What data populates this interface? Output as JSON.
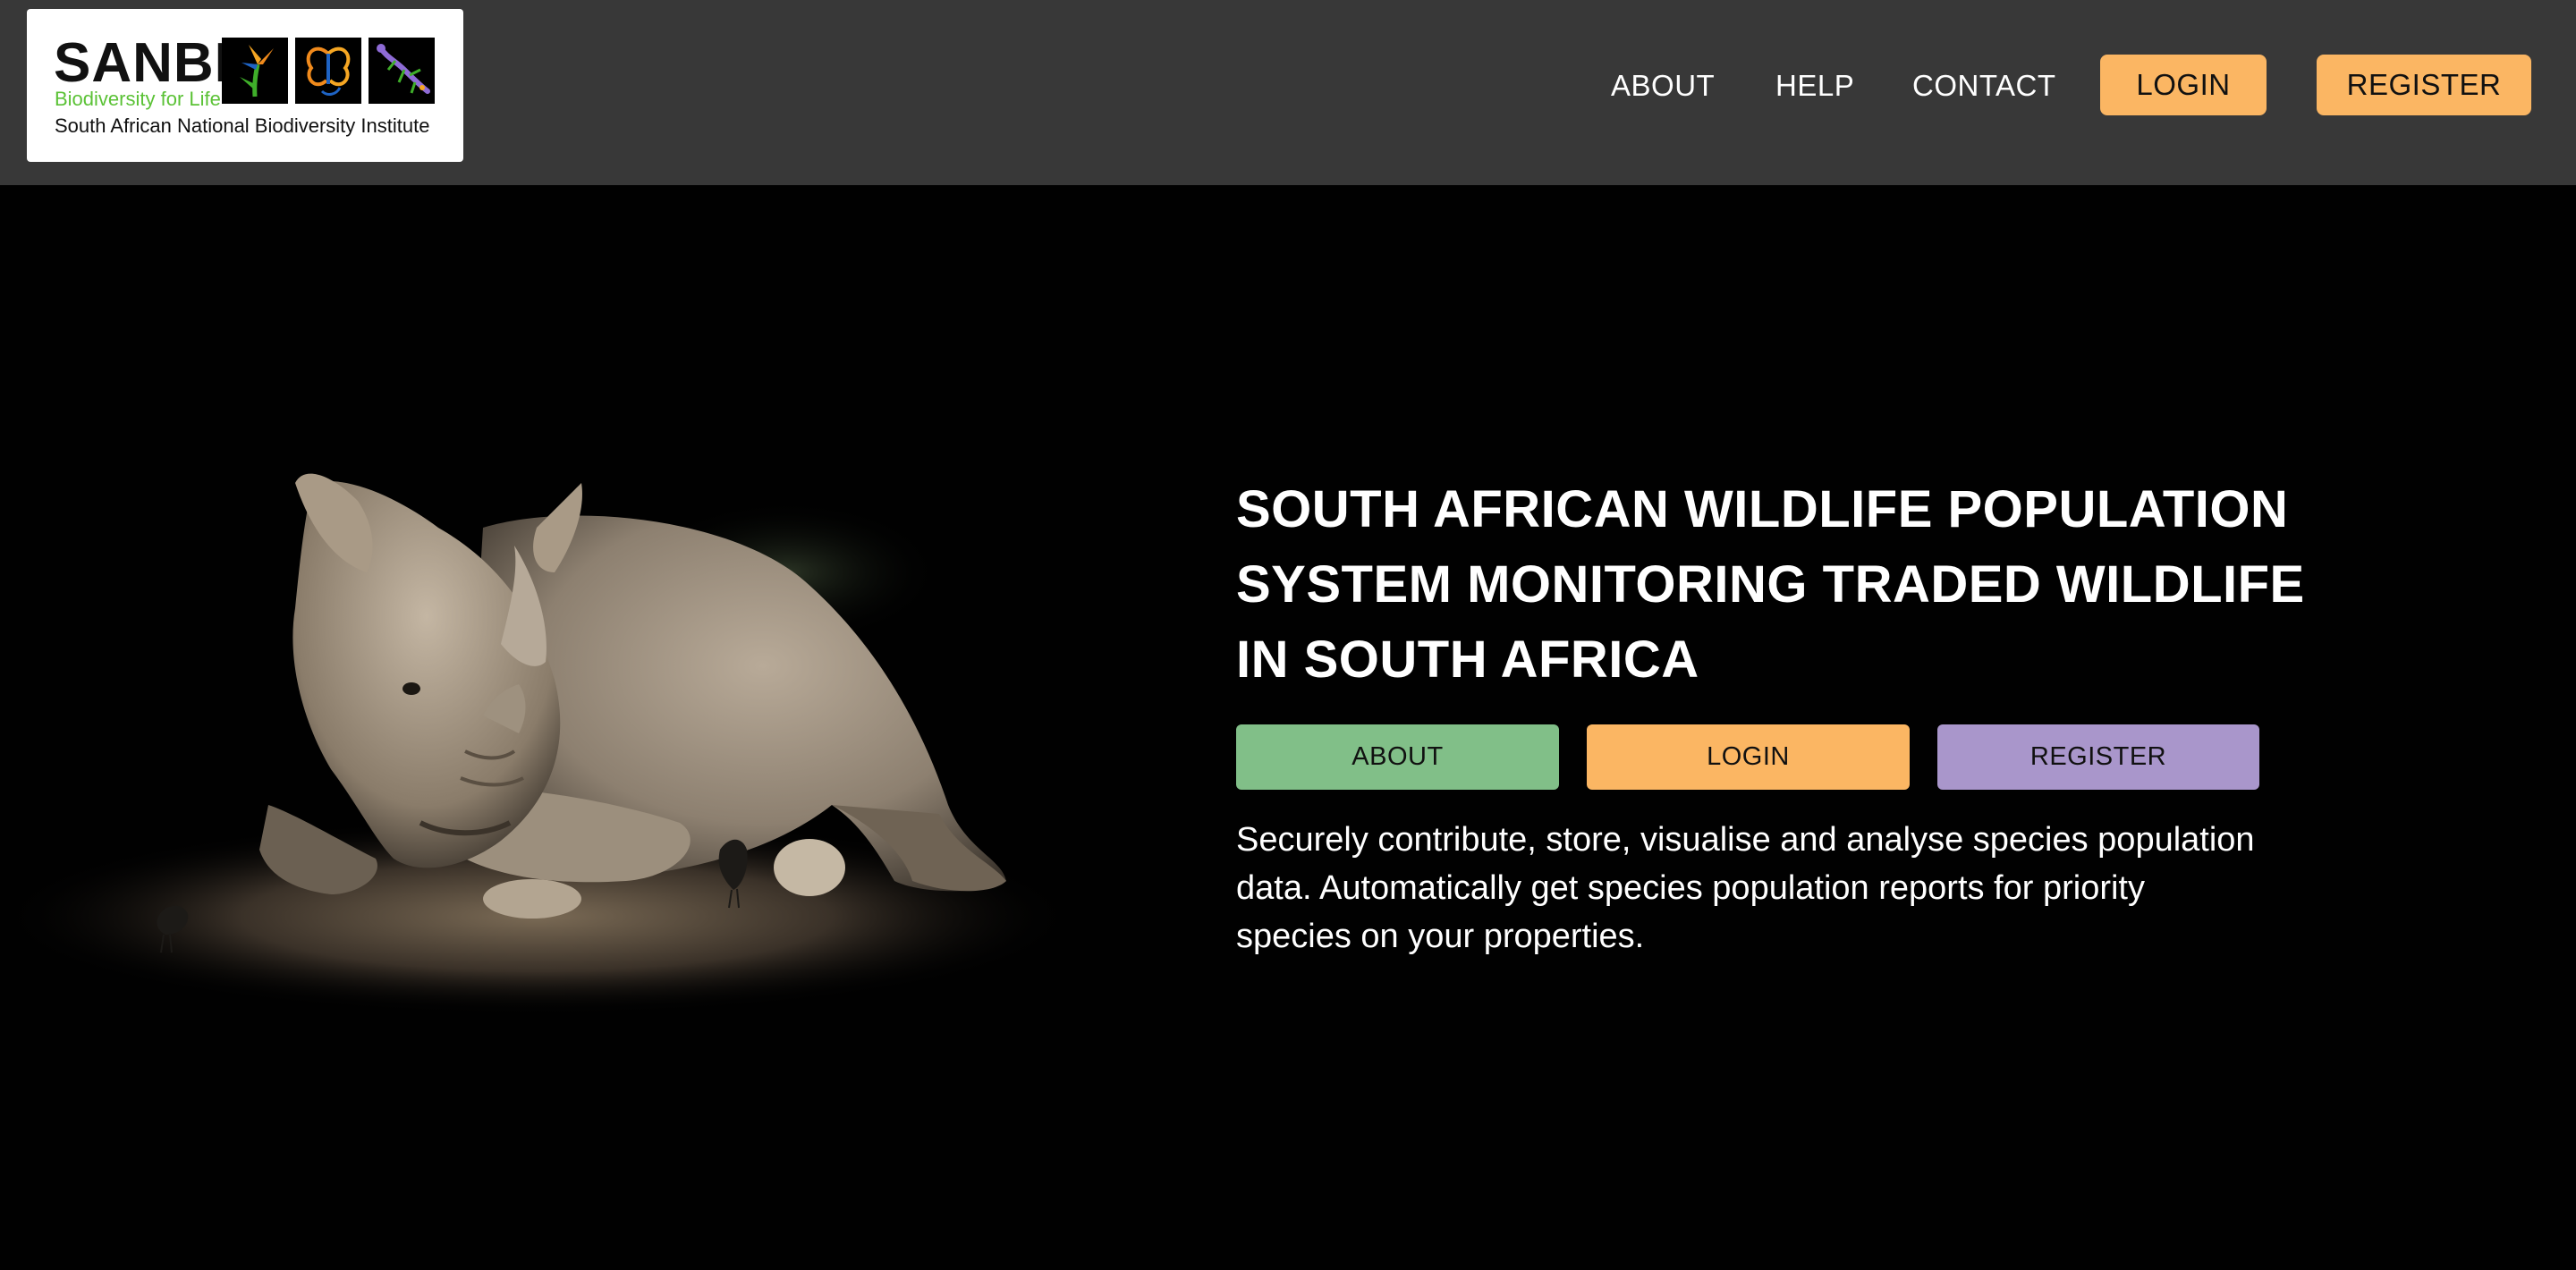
{
  "header": {
    "logo": {
      "wordmark": "SANBI",
      "tagline": "Biodiversity for Life",
      "subtitle": "South African National Biodiversity Institute"
    },
    "nav": {
      "about": "ABOUT",
      "help": "HELP",
      "contact": "CONTACT",
      "login": "LOGIN",
      "register": "REGISTER"
    }
  },
  "hero": {
    "title_lines": [
      "SOUTH AFRICAN WILDLIFE POPULATION",
      "SYSTEM MONITORING TRADED WILDLIFE",
      "IN SOUTH AFRICA"
    ],
    "buttons": {
      "about": "ABOUT",
      "login": "LOGIN",
      "register": "REGISTER"
    },
    "description_lines": [
      "Securely contribute, store, visualise and analyse species population",
      "data. Automatically get species population reports for priority",
      "species on your properties."
    ],
    "image_subject": "rhino-with-birds"
  },
  "colors": {
    "header_bg": "#383838",
    "page_bg": "#010101",
    "accent_orange": "#fbb663",
    "about_green": "#81bf88",
    "register_purple": "#a996cb",
    "logo_green": "#5bc236"
  }
}
